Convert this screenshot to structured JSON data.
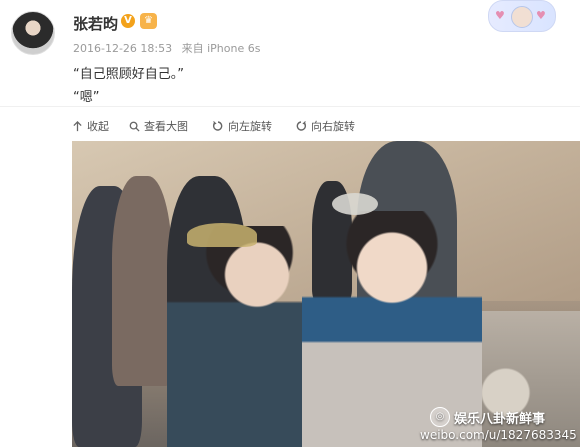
{
  "post": {
    "username": "张若昀",
    "verified_badge": "V",
    "member_badge": "♛",
    "date": "2016-12-26 18:53",
    "source": "来自 iPhone 6s",
    "line1": "“自己照顾好自己。”",
    "line2": "“嗯”"
  },
  "toolbar": {
    "collapse_label": "收起",
    "view_large_label": "查看大图",
    "rotate_left_label": "向左旋转",
    "rotate_right_label": "向右旋转"
  },
  "watermark": {
    "channel": "娱乐八卦新鲜事",
    "url": "weibo.com/u/1827683345"
  },
  "icons": {
    "collapse": "collapse-icon",
    "view_large": "search-icon",
    "rotate_left": "rotate-left-icon",
    "rotate_right": "rotate-right-icon"
  }
}
